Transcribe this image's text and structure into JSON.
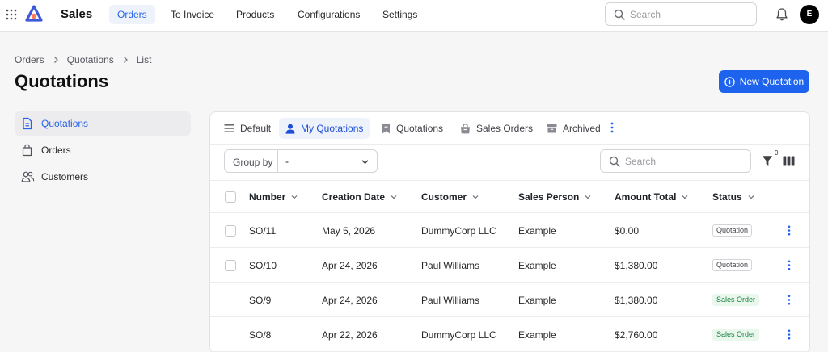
{
  "topbar": {
    "app_title": "Sales",
    "nav": [
      {
        "label": "Orders",
        "active": true
      },
      {
        "label": "To Invoice",
        "active": false
      },
      {
        "label": "Products",
        "active": false
      },
      {
        "label": "Configurations",
        "active": false
      },
      {
        "label": "Settings",
        "active": false
      }
    ],
    "search_placeholder": "Search",
    "avatar_initial": "E"
  },
  "breadcrumb": [
    "Orders",
    "Quotations",
    "List"
  ],
  "page_title": "Quotations",
  "new_button_label": "New Quotation",
  "sidebar": {
    "items": [
      {
        "label": "Quotations",
        "icon": "document-icon",
        "active": true
      },
      {
        "label": "Orders",
        "icon": "shopping-bag-icon",
        "active": false
      },
      {
        "label": "Customers",
        "icon": "users-icon",
        "active": false
      }
    ]
  },
  "views": {
    "tabs": [
      {
        "label": "Default",
        "icon": "list-icon",
        "active": false
      },
      {
        "label": "My Quotations",
        "icon": "user-icon",
        "active": true
      },
      {
        "label": "Quotations",
        "icon": "bookmark-icon",
        "active": false
      },
      {
        "label": "Sales Orders",
        "icon": "bag-icon",
        "active": false
      },
      {
        "label": "Archived",
        "icon": "archive-icon",
        "active": false
      }
    ]
  },
  "toolbar": {
    "group_by_label": "Group by",
    "group_by_value": "-",
    "search_placeholder": "Search",
    "filter_count": "0"
  },
  "table": {
    "columns": [
      "Number",
      "Creation Date",
      "Customer",
      "Sales Person",
      "Amount Total",
      "Status"
    ],
    "rows": [
      {
        "number": "SO/11",
        "date": "May 5, 2026",
        "customer": "DummyCorp LLC",
        "sales_person": "Example",
        "amount": "$0.00",
        "status": "Quotation",
        "status_kind": "quotation"
      },
      {
        "number": "SO/10",
        "date": "Apr 24, 2026",
        "customer": "Paul Williams",
        "sales_person": "Example",
        "amount": "$1,380.00",
        "status": "Quotation",
        "status_kind": "quotation"
      },
      {
        "number": "SO/9",
        "date": "Apr 24, 2026",
        "customer": "Paul Williams",
        "sales_person": "Example",
        "amount": "$1,380.00",
        "status": "Sales Order",
        "status_kind": "order"
      },
      {
        "number": "SO/8",
        "date": "Apr 22, 2026",
        "customer": "DummyCorp LLC",
        "sales_person": "Example",
        "amount": "$2,760.00",
        "status": "Sales Order",
        "status_kind": "order"
      }
    ]
  },
  "colors": {
    "accent": "#1d63ed",
    "active_bg": "#eef2fb",
    "badge_order_bg": "#e9f7ec",
    "badge_order_text": "#15803d"
  }
}
